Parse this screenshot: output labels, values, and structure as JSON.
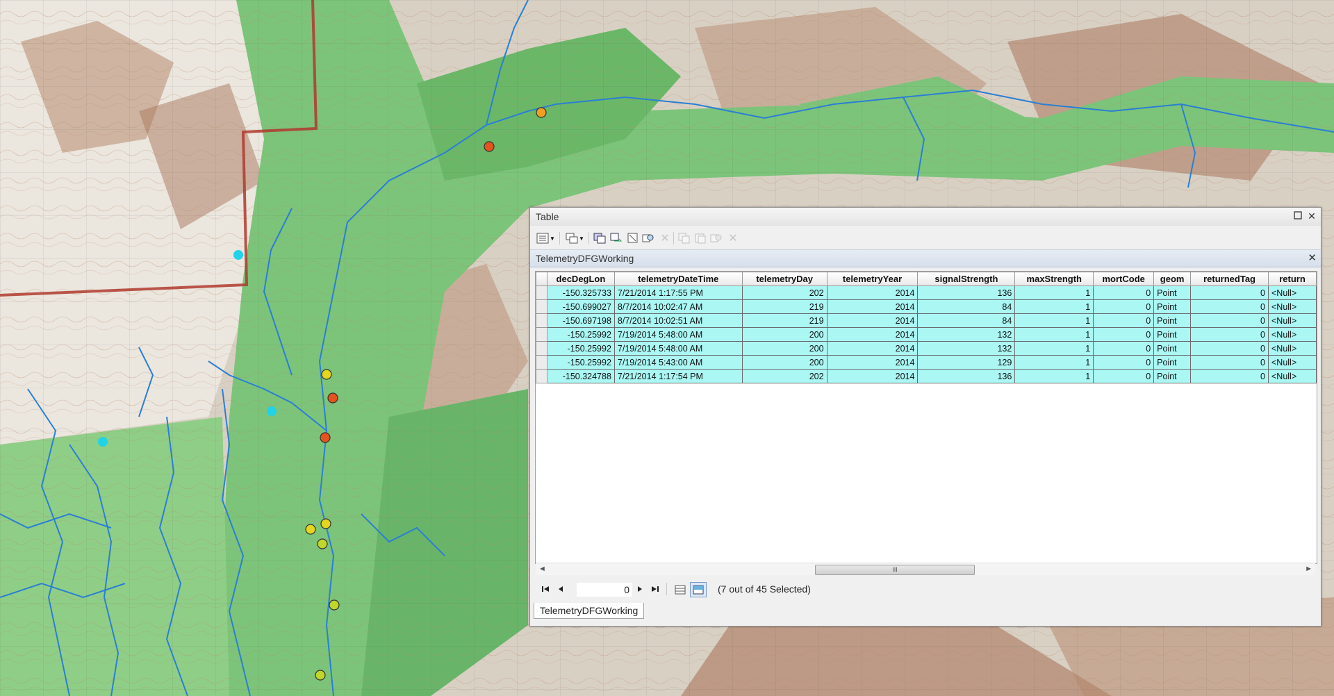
{
  "window": {
    "title": "Table",
    "maximize_icon": "maximize-icon",
    "close_icon": "close-icon"
  },
  "toolbar": {
    "icons": [
      "table-options-icon",
      "dropdown-icon",
      "related-tables-icon",
      "dropdown-icon",
      "select-by-attributes-icon",
      "switch-selection-icon",
      "clear-selection-icon",
      "zoom-to-selected-icon",
      "delete-selected-icon",
      "copy-icon",
      "paste-icon",
      "undo-icon",
      "delete-icon"
    ]
  },
  "tab": {
    "name": "TelemetryDFGWorking"
  },
  "table": {
    "columns": [
      "decDegLon",
      "telemetryDateTime",
      "telemetryDay",
      "telemetryYear",
      "signalStrength",
      "maxStrength",
      "mortCode",
      "geom",
      "returnedTag",
      "return"
    ],
    "rows": [
      [
        "-150.325733",
        "7/21/2014 1:17:55 PM",
        "202",
        "2014",
        "136",
        "1",
        "0",
        "Point",
        "0",
        "<Null>"
      ],
      [
        "-150.699027",
        "8/7/2014 10:02:47 AM",
        "219",
        "2014",
        "84",
        "1",
        "0",
        "Point",
        "0",
        "<Null>"
      ],
      [
        "-150.697198",
        "8/7/2014 10:02:51 AM",
        "219",
        "2014",
        "84",
        "1",
        "0",
        "Point",
        "0",
        "<Null>"
      ],
      [
        "-150.25992",
        "7/19/2014 5:48:00 AM",
        "200",
        "2014",
        "132",
        "1",
        "0",
        "Point",
        "0",
        "<Null>"
      ],
      [
        "-150.25992",
        "7/19/2014 5:48:00 AM",
        "200",
        "2014",
        "132",
        "1",
        "0",
        "Point",
        "0",
        "<Null>"
      ],
      [
        "-150.25992",
        "7/19/2014 5:43:00 AM",
        "200",
        "2014",
        "129",
        "1",
        "0",
        "Point",
        "0",
        "<Null>"
      ],
      [
        "-150.324788",
        "7/21/2014 1:17:54 PM",
        "202",
        "2014",
        "136",
        "1",
        "0",
        "Point",
        "0",
        "<Null>"
      ]
    ]
  },
  "navigation": {
    "record_value": "0",
    "status": "(7 out of 45 Selected)",
    "scroll_thumb_label": "III"
  },
  "bottom_tab": {
    "label": "TelemetryDFGWorking"
  },
  "colors": {
    "selected_row": "#aaf7f4",
    "map_green": "#7cc47a",
    "river_blue": "#2a7fd4",
    "boundary_red": "#b03a2e",
    "marker_cyan": "#22d3e8",
    "marker_yellow": "#e5d51c",
    "marker_orange": "#f0a020",
    "marker_red": "#e4541c",
    "marker_lime": "#bfd62a"
  }
}
